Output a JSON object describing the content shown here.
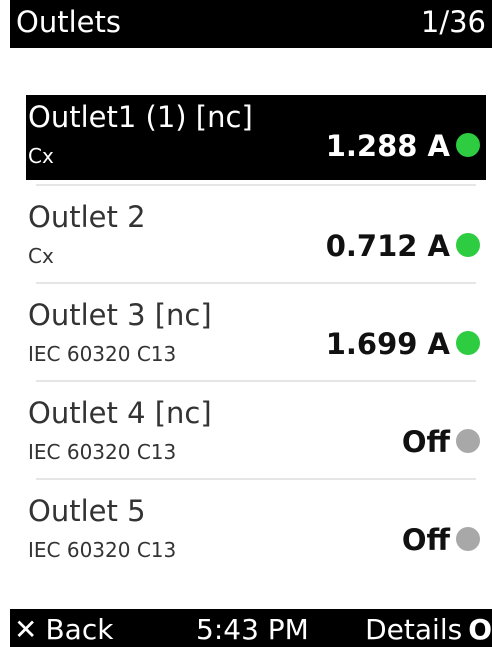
{
  "header": {
    "title": "Outlets",
    "page": "1/36"
  },
  "outlets": [
    {
      "name": "Outlet1 (1) [nc]",
      "connector": "Cx",
      "value": "1.288 A",
      "status_color": "#2ecc40"
    },
    {
      "name": "Outlet 2",
      "connector": "Cx",
      "value": "0.712 A",
      "status_color": "#2ecc40"
    },
    {
      "name": "Outlet 3 [nc]",
      "connector": "IEC 60320 C13",
      "value": "1.699 A",
      "status_color": "#2ecc40"
    },
    {
      "name": "Outlet 4 [nc]",
      "connector": "IEC 60320 C13",
      "value": "Off",
      "status_color": "#a8a8a8"
    },
    {
      "name": "Outlet 5",
      "connector": "IEC 60320 C13",
      "value": "Off",
      "status_color": "#a8a8a8"
    }
  ],
  "footer": {
    "back_icon": "✕",
    "back_label": "Back",
    "time": "5:43 PM",
    "details_label": "Details",
    "details_icon": "O"
  }
}
